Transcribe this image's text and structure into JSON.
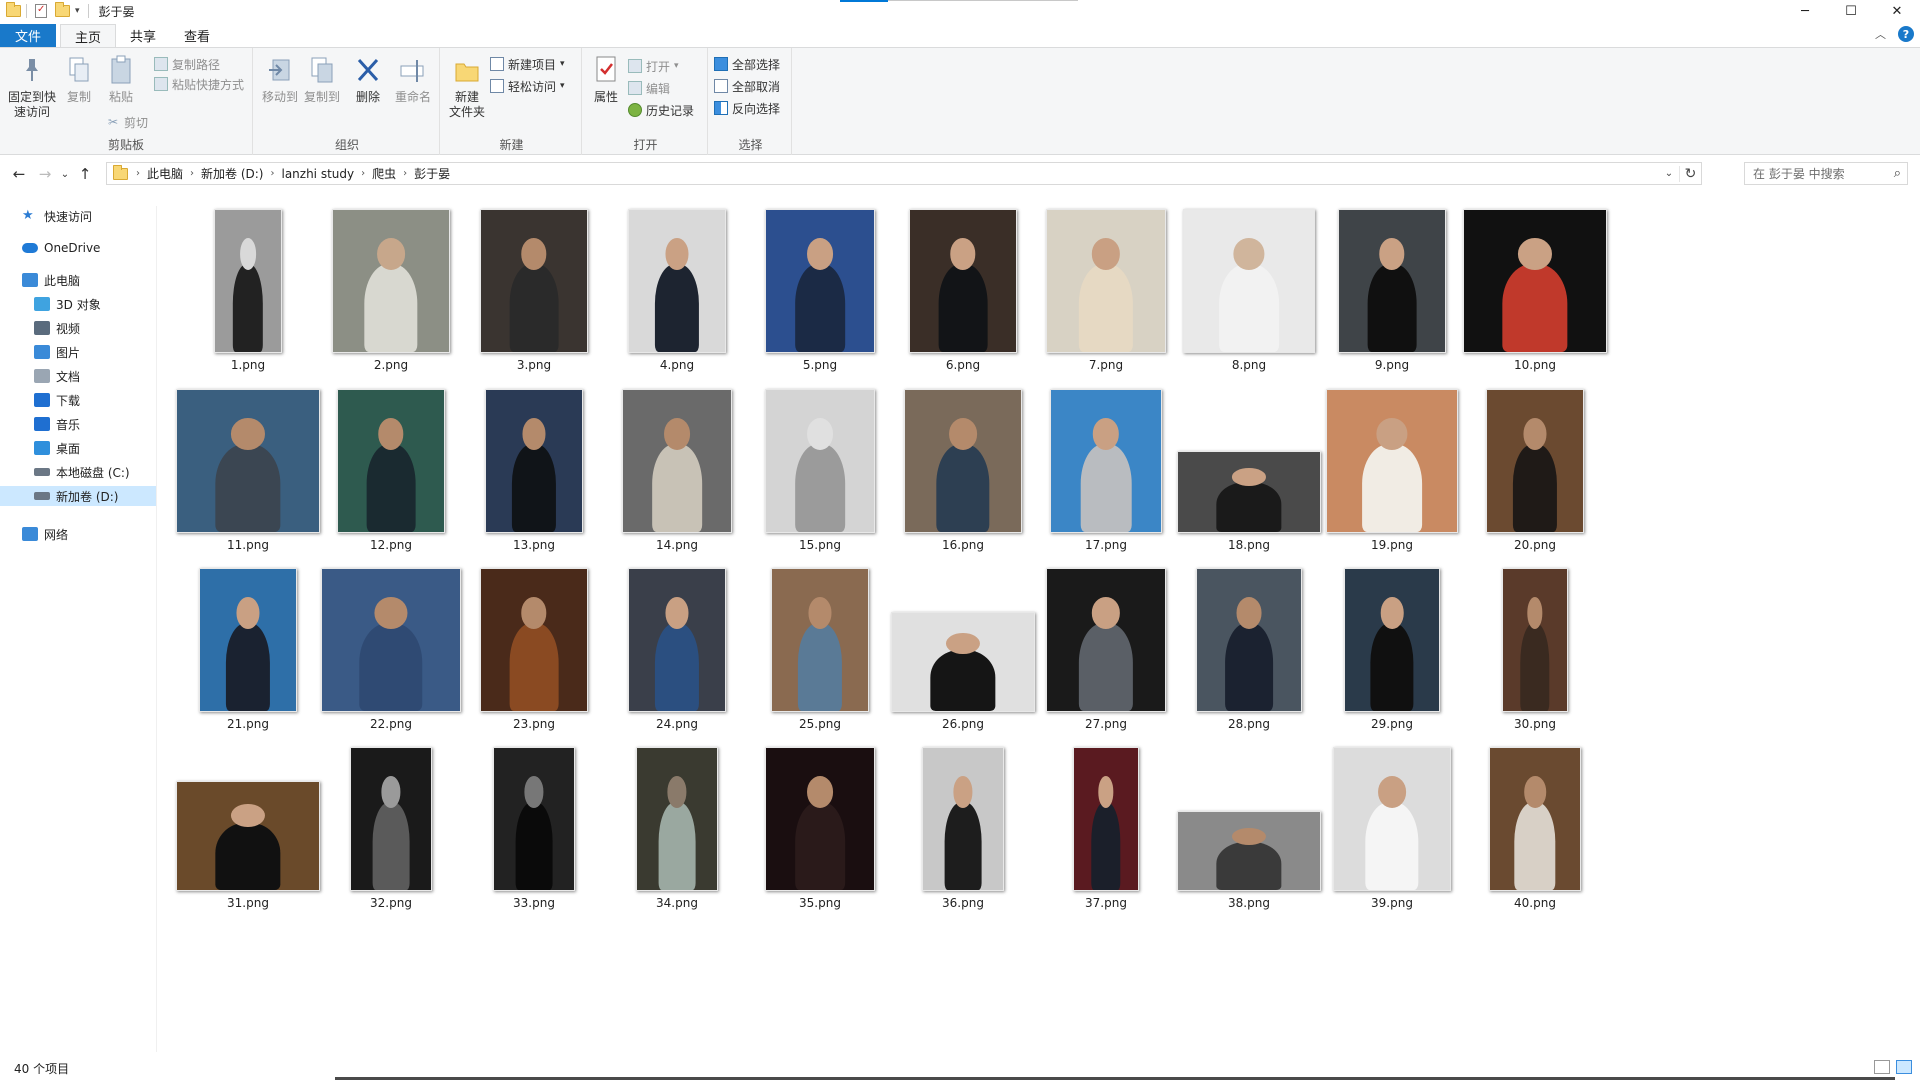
{
  "window": {
    "title": "彭于晏",
    "controls": {
      "minimize": "─",
      "maximize": "☐",
      "close": "✕"
    }
  },
  "ribbon_tabs": [
    "文件",
    "主页",
    "共享",
    "查看"
  ],
  "ribbon": {
    "clipboard": {
      "label": "剪贴板",
      "pin": "固定到快\n速访问",
      "copy": "复制",
      "paste": "粘贴",
      "copy_path": "复制路径",
      "paste_shortcut": "粘贴快捷方式",
      "cut": "剪切"
    },
    "organize": {
      "label": "组织",
      "move_to": "移动到",
      "copy_to": "复制到",
      "delete": "删除",
      "rename": "重命名"
    },
    "new": {
      "label": "新建",
      "new_folder": "新建\n文件夹",
      "new_item": "新建项目",
      "easy_access": "轻松访问"
    },
    "open": {
      "label": "打开",
      "properties": "属性",
      "open": "打开",
      "edit": "编辑",
      "history": "历史记录"
    },
    "select": {
      "label": "选择",
      "select_all": "全部选择",
      "select_none": "全部取消",
      "invert": "反向选择"
    }
  },
  "address": {
    "breadcrumbs": [
      "此电脑",
      "新加卷 (D:)",
      "lanzhi study",
      "爬虫",
      "彭于晏"
    ],
    "search_placeholder": "在 彭于晏 中搜索"
  },
  "sidebar": {
    "items": [
      {
        "label": "快速访问",
        "icon": "star-icon"
      },
      {
        "label": "OneDrive",
        "icon": "cloud-icon"
      },
      {
        "label": "此电脑",
        "icon": "computer-icon"
      },
      {
        "label": "3D 对象",
        "icon": "cube-icon"
      },
      {
        "label": "视频",
        "icon": "video-icon"
      },
      {
        "label": "图片",
        "icon": "picture-icon"
      },
      {
        "label": "文档",
        "icon": "document-icon"
      },
      {
        "label": "下载",
        "icon": "download-icon"
      },
      {
        "label": "音乐",
        "icon": "music-icon"
      },
      {
        "label": "桌面",
        "icon": "desktop-icon"
      },
      {
        "label": "本地磁盘 (C:)",
        "icon": "drive-icon"
      },
      {
        "label": "新加卷 (D:)",
        "icon": "drive-icon",
        "selected": true
      },
      {
        "label": "网络",
        "icon": "network-icon"
      }
    ]
  },
  "files": [
    "1.png",
    "2.png",
    "3.png",
    "4.png",
    "5.png",
    "6.png",
    "7.png",
    "8.png",
    "9.png",
    "10.png",
    "11.png",
    "12.png",
    "13.png",
    "14.png",
    "15.png",
    "16.png",
    "17.png",
    "18.png",
    "19.png",
    "20.png",
    "21.png",
    "22.png",
    "23.png",
    "24.png",
    "25.png",
    "26.png",
    "27.png",
    "28.png",
    "29.png",
    "30.png",
    "31.png",
    "32.png",
    "33.png",
    "34.png",
    "35.png",
    "36.png",
    "37.png",
    "38.png",
    "39.png",
    "40.png"
  ],
  "status": {
    "item_count": "40 个项目"
  },
  "colors": {
    "accent": "#1979ca",
    "selection": "#cce8ff",
    "folder": "#f8d775"
  }
}
